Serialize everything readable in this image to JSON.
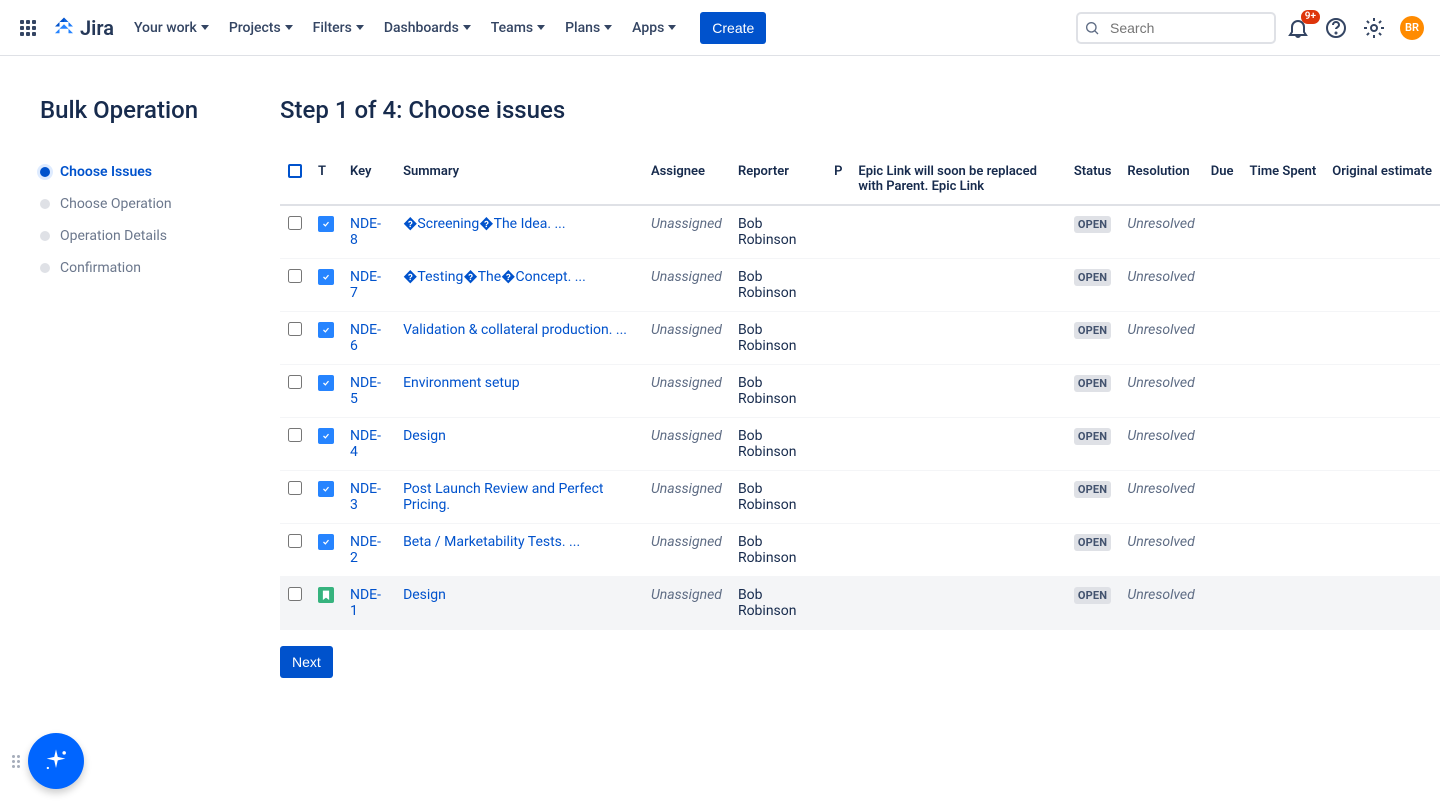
{
  "header": {
    "product": "Jira",
    "nav": [
      "Your work",
      "Projects",
      "Filters",
      "Dashboards",
      "Teams",
      "Plans",
      "Apps"
    ],
    "create_label": "Create",
    "search_placeholder": "Search",
    "notification_badge": "9+",
    "avatar_initials": "BR"
  },
  "sidebar": {
    "title": "Bulk Operation",
    "steps": [
      {
        "label": "Choose Issues",
        "active": true
      },
      {
        "label": "Choose Operation",
        "active": false
      },
      {
        "label": "Operation Details",
        "active": false
      },
      {
        "label": "Confirmation",
        "active": false
      }
    ]
  },
  "content": {
    "heading": "Step 1 of 4: Choose issues",
    "columns": [
      "",
      "T",
      "Key",
      "Summary",
      "Assignee",
      "Reporter",
      "P",
      "Epic Link will soon be replaced with Parent. Epic Link",
      "Status",
      "Resolution",
      "Due",
      "Time Spent",
      "Original estimate"
    ],
    "issues": [
      {
        "type": "task",
        "key": "NDE-8",
        "summary": "�Screening�The Idea. ...",
        "assignee": "Unassigned",
        "reporter": "Bob Robinson",
        "status": "OPEN",
        "resolution": "Unresolved"
      },
      {
        "type": "task",
        "key": "NDE-7",
        "summary": "�Testing�The�Concept. ...",
        "assignee": "Unassigned",
        "reporter": "Bob Robinson",
        "status": "OPEN",
        "resolution": "Unresolved"
      },
      {
        "type": "task",
        "key": "NDE-6",
        "summary": "Validation & collateral production. ...",
        "assignee": "Unassigned",
        "reporter": "Bob Robinson",
        "status": "OPEN",
        "resolution": "Unresolved"
      },
      {
        "type": "task",
        "key": "NDE-5",
        "summary": "Environment setup",
        "assignee": "Unassigned",
        "reporter": "Bob Robinson",
        "status": "OPEN",
        "resolution": "Unresolved"
      },
      {
        "type": "task",
        "key": "NDE-4",
        "summary": "Design",
        "assignee": "Unassigned",
        "reporter": "Bob Robinson",
        "status": "OPEN",
        "resolution": "Unresolved"
      },
      {
        "type": "task",
        "key": "NDE-3",
        "summary": "Post Launch Review and Perfect Pricing.",
        "assignee": "Unassigned",
        "reporter": "Bob Robinson",
        "status": "OPEN",
        "resolution": "Unresolved"
      },
      {
        "type": "task",
        "key": "NDE-2",
        "summary": "Beta / Marketability Tests. ...",
        "assignee": "Unassigned",
        "reporter": "Bob Robinson",
        "status": "OPEN",
        "resolution": "Unresolved"
      },
      {
        "type": "story",
        "key": "NDE-1",
        "summary": "Design",
        "assignee": "Unassigned",
        "reporter": "Bob Robinson",
        "status": "OPEN",
        "resolution": "Unresolved",
        "hovered": true
      }
    ],
    "next_label": "Next"
  }
}
